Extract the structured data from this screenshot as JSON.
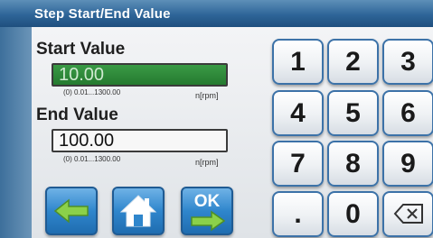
{
  "window": {
    "title": "Step Start/End Value"
  },
  "start": {
    "label": "Start Value",
    "value": "10.00",
    "range": "(0) 0.01...1300.00",
    "unit": "n[rpm]"
  },
  "end": {
    "label": "End Value",
    "value": "100.00",
    "range": "(0) 0.01...1300.00",
    "unit": "n[rpm]"
  },
  "keypad": {
    "k1": "1",
    "k2": "2",
    "k3": "3",
    "k4": "4",
    "k5": "5",
    "k6": "6",
    "k7": "7",
    "k8": "8",
    "k9": "9",
    "kdot": ".",
    "k0": "0"
  },
  "nav": {
    "ok_label": "OK"
  },
  "colors": {
    "accent": "#2f86cc",
    "active_field": "#2a8a37",
    "title_bar": "#2e6598"
  }
}
